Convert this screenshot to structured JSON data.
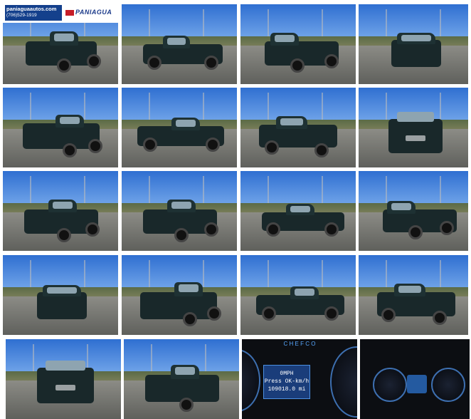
{
  "watermark": {
    "site": "paniaguaautos.com",
    "phone": "(706)529-1919",
    "brand": "PANIAGUA"
  },
  "gallery": {
    "photos": [
      {
        "view": "front-left"
      },
      {
        "view": "left-side"
      },
      {
        "view": "rear-left"
      },
      {
        "view": "rear"
      },
      {
        "view": "rear-left"
      },
      {
        "view": "left-side"
      },
      {
        "view": "front-right"
      },
      {
        "view": "front"
      },
      {
        "view": "front-left"
      },
      {
        "view": "front-left"
      },
      {
        "view": "left-side"
      },
      {
        "view": "rear-right"
      },
      {
        "view": "rear"
      },
      {
        "view": "rear-right"
      },
      {
        "view": "right-side"
      },
      {
        "view": "front-right"
      },
      {
        "view": "front"
      },
      {
        "view": "front-left"
      },
      {
        "view": "dashboard-display"
      },
      {
        "view": "instrument-cluster"
      }
    ]
  },
  "dashboard": {
    "top_text": "C H E F C O",
    "speed": "0MPH",
    "message": "Press OK-km/h",
    "odometer": "109018.0 mi"
  },
  "colors": {
    "truck": "#19282a",
    "brand": "#14408c",
    "brand_red": "#c61d27"
  }
}
